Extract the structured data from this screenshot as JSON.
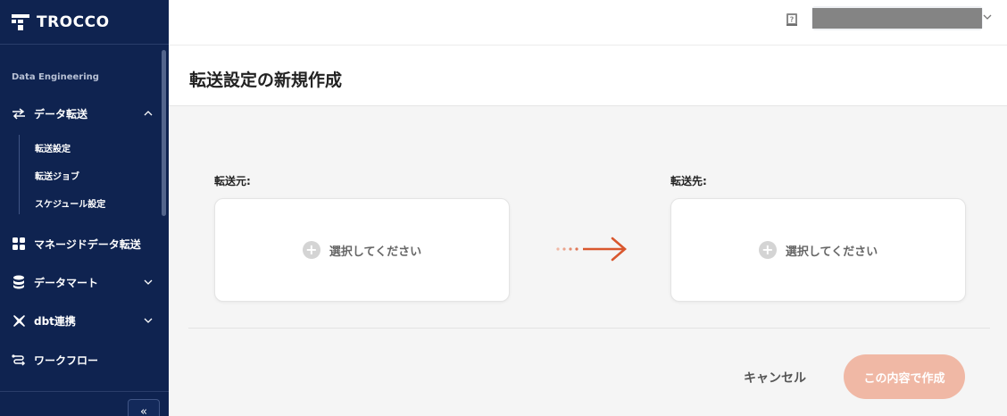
{
  "app": {
    "name": "TROCCO"
  },
  "sidebar": {
    "section": "Data Engineering",
    "items": [
      {
        "label": "データ転送",
        "icon": "arrows-swap-icon",
        "expanded": true
      },
      {
        "label": "マネージドデータ転送",
        "icon": "grid-icon"
      },
      {
        "label": "データマート",
        "icon": "database-icon"
      },
      {
        "label": "dbt連携",
        "icon": "dbt-icon"
      },
      {
        "label": "ワークフロー",
        "icon": "workflow-icon"
      }
    ],
    "sub_items": [
      {
        "label": "転送設定"
      },
      {
        "label": "転送ジョブ"
      },
      {
        "label": "スケジュール設定"
      }
    ],
    "collapse_label": "«"
  },
  "header": {
    "help_icon": "help-book-icon",
    "user_menu_icon": "chevron-down-icon"
  },
  "page": {
    "title": "転送設定の新規作成",
    "source_label": "転送元:",
    "destination_label": "転送先:",
    "source_placeholder": "選択してください",
    "destination_placeholder": "選択してください",
    "cancel_label": "キャンセル",
    "create_label": "この内容で作成"
  },
  "colors": {
    "sidebar_bg": "#0f2350",
    "accent_arrow": "#d9572e",
    "create_button_disabled": "#f0b8a5"
  }
}
